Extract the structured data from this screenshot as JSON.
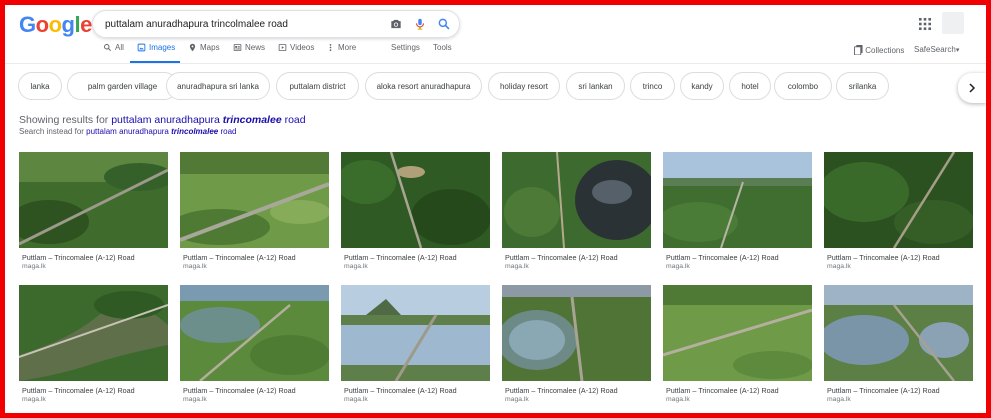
{
  "logo": {
    "letters": [
      "G",
      "o",
      "o",
      "g",
      "l",
      "e"
    ],
    "colors": [
      "#4285f4",
      "#ea4335",
      "#fbbc05",
      "#4285f4",
      "#34a853",
      "#ea4335"
    ]
  },
  "search": {
    "query": "puttalam anuradhapura trincolmalee road"
  },
  "tabs": [
    {
      "label": "All",
      "icon": "search-icon"
    },
    {
      "label": "Images",
      "icon": "image-icon",
      "active": true
    },
    {
      "label": "Maps",
      "icon": "map-pin-icon"
    },
    {
      "label": "News",
      "icon": "news-icon"
    },
    {
      "label": "Videos",
      "icon": "video-icon"
    },
    {
      "label": "More",
      "icon": "more-vert-icon"
    }
  ],
  "tools": {
    "settings": "Settings",
    "tools": "Tools"
  },
  "right": {
    "collections": "Collections",
    "safesearch": "SafeSearch"
  },
  "chips": [
    "lanka",
    "palm garden village",
    "anuradhapura sri lanka",
    "puttalam district",
    "aloka resort anuradhapura",
    "holiday resort",
    "sri lankan",
    "trinco",
    "kandy",
    "hotel",
    "colombo",
    "srilanka"
  ],
  "correction": {
    "showing_prefix": "Showing results for ",
    "showing_plain": "puttalam anuradhapura ",
    "showing_bold": "trincomalee",
    "showing_suffix": " road",
    "instead_prefix": "Search instead for ",
    "instead_plain": "puttalam anuradhapura ",
    "instead_bold": "trincolmalee",
    "instead_suffix": " road"
  },
  "results": [
    {
      "title": "Puttlam – Trincomalee (A-12) Road",
      "source": "maga.lk"
    },
    {
      "title": "Puttlam – Trincomalee (A-12) Road",
      "source": "maga.lk"
    },
    {
      "title": "Puttlam – Trincomalee (A-12) Road",
      "source": "maga.lk"
    },
    {
      "title": "Puttlam – Trincomalee (A-12) Road",
      "source": "maga.lk"
    },
    {
      "title": "Puttlam – Trincomalee (A-12) Road",
      "source": "maga.lk"
    },
    {
      "title": "Puttlam – Trincomalee (A-12) Road",
      "source": "maga.lk"
    },
    {
      "title": "Puttlam – Trincomalee (A-12) Road",
      "source": "maga.lk"
    },
    {
      "title": "Puttlam – Trincomalee (A-12) Road",
      "source": "maga.lk"
    },
    {
      "title": "Puttlam – Trincomalee (A-12) Road",
      "source": "maga.lk"
    },
    {
      "title": "Puttlam – Trincomalee (A-12) Road",
      "source": "maga.lk"
    },
    {
      "title": "Puttlam – Trincomalee (A-12) Road",
      "source": "maga.lk"
    },
    {
      "title": "Puttlam – Trincomalee (A-12) Road",
      "source": "maga.lk"
    }
  ],
  "colors": {
    "accent": "#1a73e8",
    "link": "#1a0dab",
    "frame": "#f00000"
  }
}
